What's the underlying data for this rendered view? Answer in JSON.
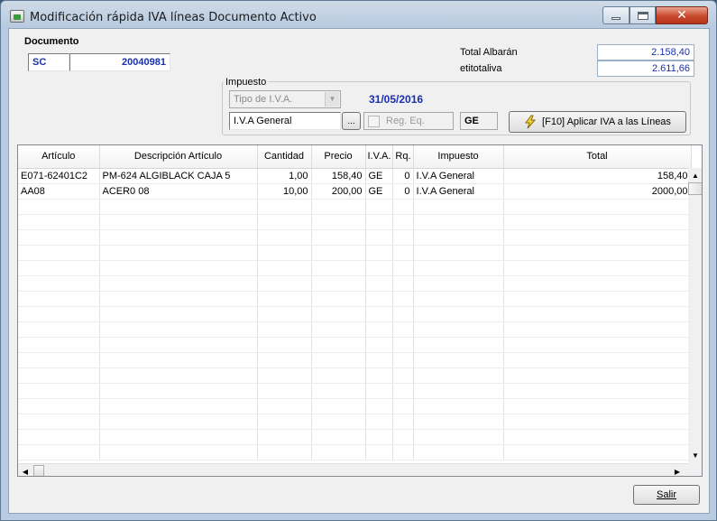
{
  "window": {
    "title": "Modificación rápida IVA líneas Documento Activo",
    "controls": {
      "minimize": "minimize-icon",
      "maximize": "maximize-icon",
      "close": "✕"
    }
  },
  "documento": {
    "label": "Documento",
    "serie": "SC",
    "numero": "20040981"
  },
  "totales": {
    "total_albaran_label": "Total Albarán",
    "total_albaran": "2.158,40",
    "etitotaliva_label": "etitotaliva",
    "etitotaliva": "2.611,66"
  },
  "impuesto": {
    "label": "Impuesto",
    "tipo_placeholder": "Tipo de I.V.A.",
    "fecha": "31/05/2016",
    "nombre": "I.V.A General",
    "browse_label": "...",
    "reg_eq_label": "Reg. Eq.",
    "reg_eq_checked": false,
    "codigo": "GE",
    "apply_label": "[F10]  Aplicar IVA a las Líneas"
  },
  "grid": {
    "columns": [
      "Artículo",
      "Descripción Artículo",
      "Cantidad",
      "Precio",
      "I.V.A.",
      "Rq.",
      "Impuesto",
      "Total"
    ],
    "rows": [
      [
        "E071-62401C2",
        "PM-624 ALGIBLACK CAJA 5",
        "1,00",
        "158,40",
        "GE",
        "0",
        "I.V.A General",
        "158,40"
      ],
      [
        "AA08",
        "ACER0 08",
        "10,00",
        "200,00",
        "GE",
        "0",
        "I.V.A General",
        "2000,00"
      ]
    ],
    "empty_rows": 17
  },
  "footer": {
    "salir_label": "Salir"
  },
  "colors": {
    "accent_blue": "#1a2fb0",
    "close_red": "#c94a2e"
  }
}
